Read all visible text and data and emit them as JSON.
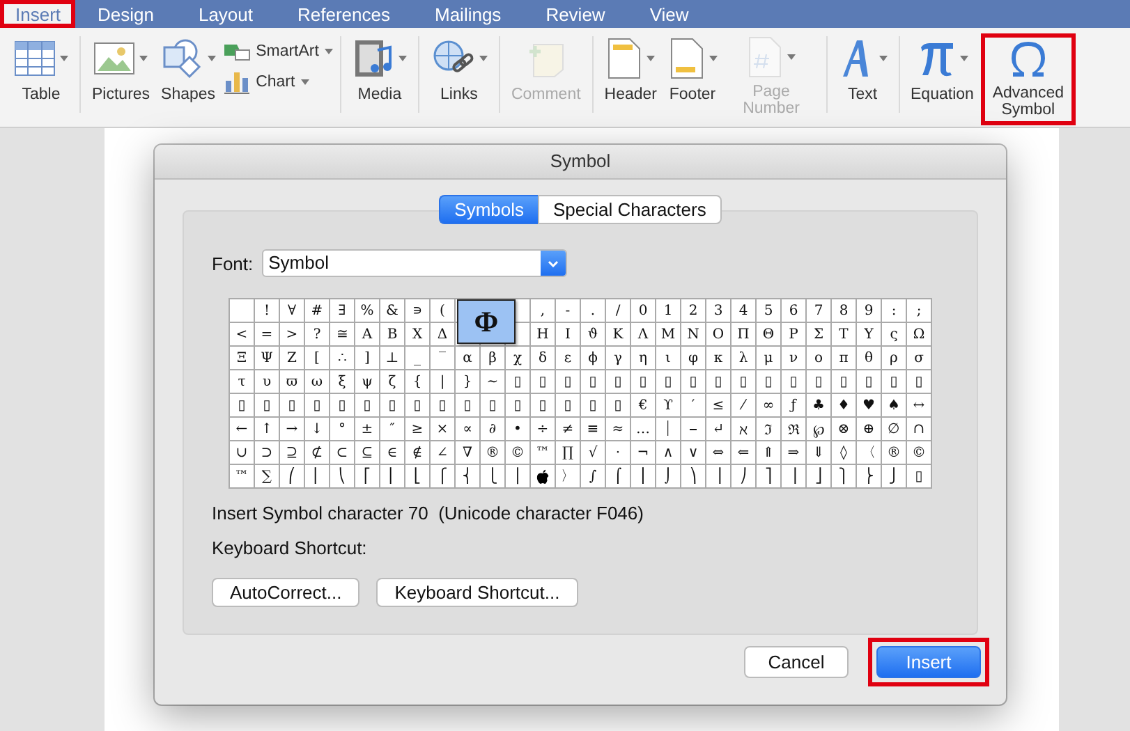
{
  "menu_tabs": [
    {
      "label": "Insert",
      "selected": true,
      "highlighted": true
    },
    {
      "label": "Design",
      "selected": false,
      "highlighted": false
    },
    {
      "label": "Layout",
      "selected": false,
      "highlighted": false
    },
    {
      "label": "References",
      "selected": false,
      "highlighted": false
    },
    {
      "label": "Mailings",
      "selected": false,
      "highlighted": false
    },
    {
      "label": "Review",
      "selected": false,
      "highlighted": false
    },
    {
      "label": "View",
      "selected": false,
      "highlighted": false
    }
  ],
  "ribbon_groups": [
    {
      "items": [
        {
          "kind": "large",
          "label": "Table",
          "menu": true,
          "disabled": false,
          "highlighted": false
        }
      ]
    },
    {
      "items": [
        {
          "kind": "large",
          "label": "Pictures",
          "menu": true,
          "disabled": false,
          "highlighted": false
        },
        {
          "kind": "large",
          "label": "Shapes",
          "menu": true,
          "disabled": false,
          "highlighted": false
        },
        {
          "kind": "small",
          "label": "SmartArt",
          "menu": true,
          "disabled": false,
          "highlighted": false
        },
        {
          "kind": "small",
          "label": "Chart",
          "menu": true,
          "disabled": false,
          "highlighted": false
        }
      ]
    },
    {
      "items": [
        {
          "kind": "large",
          "label": "Media",
          "menu": true,
          "disabled": false,
          "highlighted": false
        }
      ]
    },
    {
      "items": [
        {
          "kind": "large",
          "label": "Links",
          "menu": true,
          "disabled": false,
          "highlighted": false
        }
      ]
    },
    {
      "items": [
        {
          "kind": "large",
          "label": "Comment",
          "menu": false,
          "disabled": true,
          "highlighted": false
        }
      ]
    },
    {
      "items": [
        {
          "kind": "large",
          "label": "Header",
          "menu": true,
          "disabled": false,
          "highlighted": false
        },
        {
          "kind": "large",
          "label": "Footer",
          "menu": true,
          "disabled": false,
          "highlighted": false
        },
        {
          "kind": "large",
          "label": "Page Number",
          "menu": true,
          "disabled": true,
          "highlighted": false
        }
      ]
    },
    {
      "items": [
        {
          "kind": "large",
          "label": "Text",
          "menu": true,
          "disabled": false,
          "highlighted": false
        }
      ]
    },
    {
      "items": [
        {
          "kind": "large",
          "label": "Equation",
          "menu": true,
          "disabled": false,
          "highlighted": false
        },
        {
          "kind": "large",
          "label": "Advanced Symbol",
          "menu": false,
          "disabled": false,
          "highlighted": true
        }
      ]
    }
  ],
  "dialog": {
    "title": "Symbol",
    "tabs": [
      {
        "label": "Symbols",
        "selected": true
      },
      {
        "label": "Special Characters",
        "selected": false
      }
    ],
    "font": {
      "label": "Font:",
      "value": "Symbol"
    },
    "grid_rows": [
      [
        null,
        "!",
        "∀",
        "#",
        "∃",
        "%",
        "&",
        "∍",
        "(",
        null,
        null,
        null,
        ",",
        "-",
        ".",
        "/",
        "0",
        "1",
        "2",
        "3",
        "4",
        "5",
        "6",
        "7",
        "8",
        "9",
        ":",
        ";"
      ],
      [
        "<",
        "=",
        ">",
        "?",
        "≅",
        "Α",
        "Β",
        "Χ",
        "Δ",
        null,
        null,
        null,
        "Η",
        "Ι",
        "ϑ",
        "Κ",
        "Λ",
        "Μ",
        "Ν",
        "Ο",
        "Π",
        "Θ",
        "Ρ",
        "Σ",
        "Τ",
        "Υ",
        "ς",
        "Ω"
      ],
      [
        "Ξ",
        "Ψ",
        "Ζ",
        "[",
        "∴",
        "]",
        "⊥",
        "_",
        "‾",
        "α",
        "β",
        "χ",
        "δ",
        "ε",
        "ϕ",
        "γ",
        "η",
        "ι",
        "φ",
        "κ",
        "λ",
        "μ",
        "ν",
        "ο",
        "π",
        "θ",
        "ρ",
        "σ"
      ],
      [
        "τ",
        "υ",
        "ϖ",
        "ω",
        "ξ",
        "ψ",
        "ζ",
        "{",
        "|",
        "}",
        "∼",
        "▯",
        "▯",
        "▯",
        "▯",
        "▯",
        "▯",
        "▯",
        "▯",
        "▯",
        "▯",
        "▯",
        "▯",
        "▯",
        "▯",
        "▯",
        "▯",
        "▯"
      ],
      [
        "▯",
        "▯",
        "▯",
        "▯",
        "▯",
        "▯",
        "▯",
        "▯",
        "▯",
        "▯",
        "▯",
        "▯",
        "▯",
        "▯",
        "▯",
        "▯",
        "€",
        "ϒ",
        "′",
        "≤",
        "⁄",
        "∞",
        "ƒ",
        "♣",
        "♦",
        "♥",
        "♠",
        "↔"
      ],
      [
        "←",
        "↑",
        "→",
        "↓",
        "°",
        "±",
        "″",
        "≥",
        "×",
        "∝",
        "∂",
        "•",
        "÷",
        "≠",
        "≡",
        "≈",
        "…",
        "⏐",
        "⎯",
        "↵",
        "ℵ",
        "ℑ",
        "ℜ",
        "℘",
        "⊗",
        "⊕",
        "∅",
        "∩"
      ],
      [
        "∪",
        "⊃",
        "⊇",
        "⊄",
        "⊂",
        "⊆",
        "∈",
        "∉",
        "∠",
        "∇",
        "®",
        "©",
        "™",
        "∏",
        "√",
        "⋅",
        "¬",
        "∧",
        "∨",
        "⇔",
        "⇐",
        "⇑",
        "⇒",
        "⇓",
        "◊",
        "〈",
        "®",
        "©"
      ],
      [
        "™",
        "∑",
        "⎛",
        "⎜",
        "⎝",
        "⎡",
        "⎢",
        "⎣",
        "⎧",
        "⎨",
        "⎩",
        "⎪",
        {
          "kind": "icon"
        },
        "〉",
        "∫",
        "⌠",
        "⎮",
        "⌡",
        "⎞",
        "⎟",
        "⎠",
        "⎤",
        "⎥",
        "⎦",
        "⎫",
        "⎬",
        "⎭",
        "▯"
      ]
    ],
    "magnified": "Φ",
    "info": "Insert Symbol character 70  (Unicode character F046)",
    "shortcut_label": "Keyboard Shortcut:",
    "option_buttons": [
      "AutoCorrect...",
      "Keyboard Shortcut..."
    ],
    "footer_buttons": [
      {
        "label": "Cancel",
        "default": false,
        "highlighted": false
      },
      {
        "label": "Insert",
        "default": true,
        "highlighted": true
      }
    ]
  }
}
